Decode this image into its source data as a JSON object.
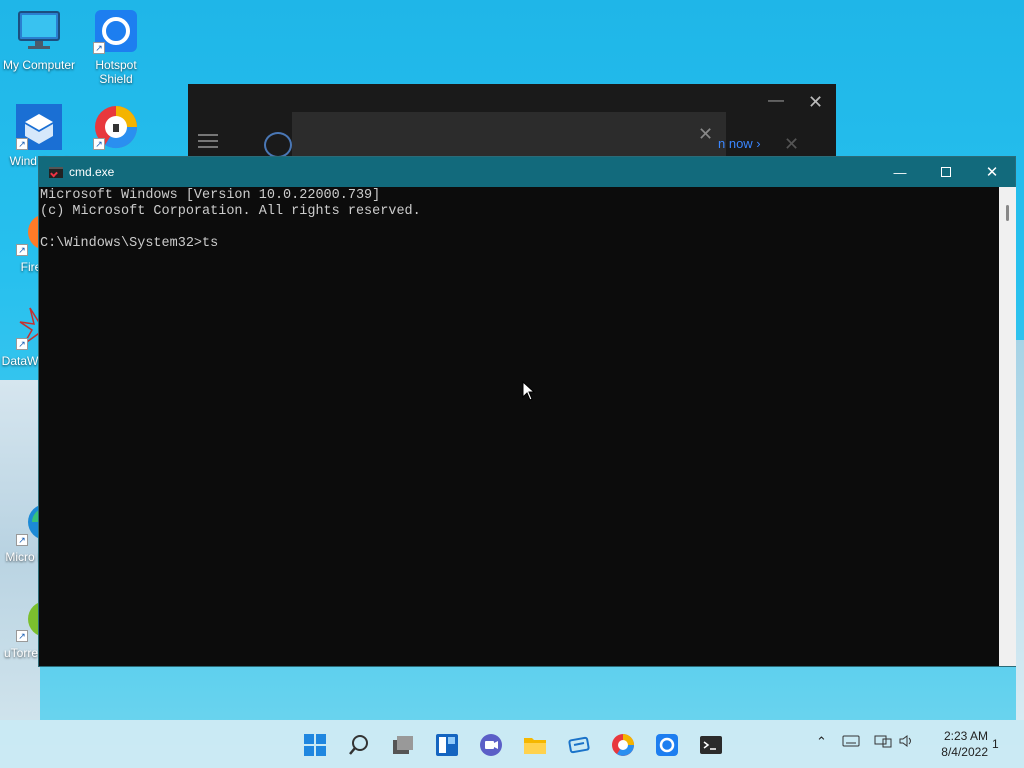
{
  "desktop": {
    "icons": [
      {
        "label": "My Computer"
      },
      {
        "label": "Hotspot Shield"
      },
      {
        "label": "Wind Sand"
      },
      {
        "label": "Fire"
      },
      {
        "label": "DataW"
      },
      {
        "label": "Micro Ed"
      },
      {
        "label": "uTorre"
      }
    ]
  },
  "background_window": {
    "promo_text": "n now ›"
  },
  "cmd": {
    "title": "cmd.exe",
    "lines": [
      "Microsoft Windows [Version 10.0.22000.739]",
      "(c) Microsoft Corporation. All rights reserved.",
      "",
      "C:\\Windows\\System32>ts"
    ]
  },
  "taskbar": {
    "apps": [
      "start-icon",
      "search-icon",
      "task-view-icon",
      "widgets-icon",
      "teams-chat-icon",
      "file-explorer-icon",
      "app-icon",
      "browser-icon",
      "hotspot-shield-icon",
      "terminal-icon"
    ],
    "clock": {
      "time": "2:23 AM",
      "date": "8/4/2022"
    },
    "notification_count": "1"
  },
  "colors": {
    "titlebar": "#126a7c",
    "console_bg": "#0c0c0c",
    "console_fg": "#cccccc"
  }
}
